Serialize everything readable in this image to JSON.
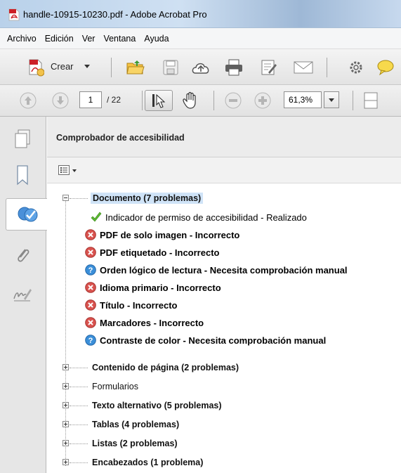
{
  "window": {
    "title": "handle-10915-10230.pdf - Adobe Acrobat Pro",
    "app_icon": "acrobat-pdf-icon",
    "accent": "#cc2027"
  },
  "menubar": {
    "items": [
      "Archivo",
      "Edición",
      "Ver",
      "Ventana",
      "Ayuda"
    ]
  },
  "toolbar": {
    "create_label": "Crear",
    "icons": [
      "create-icon",
      "open-folder-icon",
      "save-icon",
      "cloud-upload-icon",
      "print-icon",
      "edit-sign-icon",
      "mail-icon",
      "settings-icon",
      "comment-icon"
    ]
  },
  "navigation": {
    "current_page": "1",
    "total_pages": "/ 22",
    "zoom": "61,3%",
    "icons": [
      "page-up-icon",
      "page-down-icon",
      "select-tool-icon",
      "hand-tool-icon",
      "zoom-out-icon",
      "zoom-in-icon",
      "fit-page-icon"
    ]
  },
  "left_nav": {
    "icons": [
      "pages-icon",
      "bookmarks-icon",
      "accessibility-checker-icon",
      "attachments-icon",
      "signatures-icon"
    ]
  },
  "panel": {
    "title": "Comprobador de accesibilidad",
    "options_icon": "options-menu-icon"
  },
  "tree": {
    "document_group": {
      "label": "Documento (7 problemas)",
      "items": [
        {
          "text": "Indicador de permiso de accesibilidad - Realizado",
          "status": "passed",
          "bold": false
        },
        {
          "text": "PDF de solo imagen - Incorrecto",
          "status": "failed",
          "bold": true
        },
        {
          "text": "PDF etiquetado - Incorrecto",
          "status": "failed",
          "bold": true
        },
        {
          "text": "Orden lógico de lectura - Necesita comprobación manual",
          "status": "manual",
          "bold": true
        },
        {
          "text": "Idioma primario - Incorrecto",
          "status": "failed",
          "bold": true
        },
        {
          "text": "Título - Incorrecto",
          "status": "failed",
          "bold": true
        },
        {
          "text": "Marcadores - Incorrecto",
          "status": "failed",
          "bold": true
        },
        {
          "text": "Contraste de color - Necesita comprobación manual",
          "status": "manual",
          "bold": true
        }
      ]
    },
    "groups": [
      {
        "label": "Contenido de página (2 problemas)",
        "bold": true
      },
      {
        "label": "Formularios",
        "bold": false
      },
      {
        "label": "Texto alternativo (5 problemas)",
        "bold": true
      },
      {
        "label": "Tablas (4 problemas)",
        "bold": true
      },
      {
        "label": "Listas (2 problemas)",
        "bold": true
      },
      {
        "label": "Encabezados (1 problema)",
        "bold": true
      }
    ]
  },
  "colors": {
    "passed": "#4caf2a",
    "failed": "#d9534f",
    "manual": "#3b8fd9",
    "selection": "#cfe3f7"
  }
}
